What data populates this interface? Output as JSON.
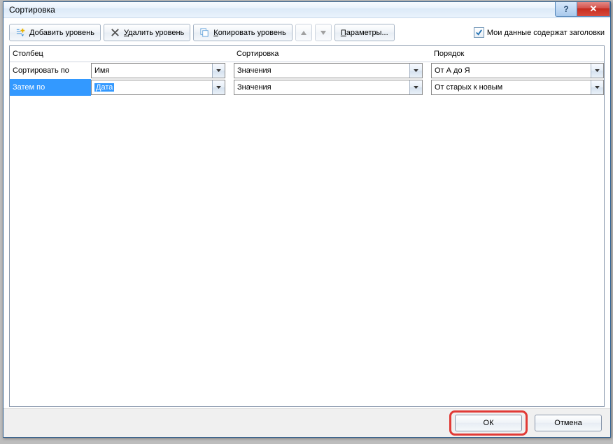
{
  "window": {
    "title": "Сортировка"
  },
  "toolbar": {
    "add_level": "обавить уровень",
    "add_level_accel": "Д",
    "delete_level": "далить уровень",
    "delete_level_accel": "У",
    "copy_level": "опировать уровень",
    "copy_level_accel": "К",
    "options": "араметры...",
    "options_accel": "П",
    "headers_label": "Мои данные содержат заголовки"
  },
  "headers": {
    "col": "Столбец",
    "sort_on": "Сортировка",
    "order": "Порядок"
  },
  "rows": [
    {
      "label": "Сортировать по",
      "column": "Имя",
      "sort_on": "Значения",
      "order": "От А до Я",
      "selected": false
    },
    {
      "label": "Затем по",
      "column": "Дата",
      "sort_on": "Значения",
      "order": "От старых к новым",
      "selected": true
    }
  ],
  "footer": {
    "ok": "ОК",
    "cancel": "Отмена"
  }
}
